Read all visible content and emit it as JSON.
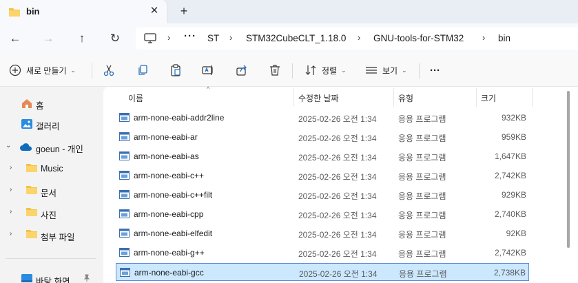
{
  "tab": {
    "title": "bin",
    "close_glyph": "✕",
    "new_glyph": "+"
  },
  "nav": {
    "back": "←",
    "forward": "→",
    "up": "↑",
    "refresh": "↻"
  },
  "breadcrumb": {
    "more": "···",
    "sep": "›",
    "items": [
      "ST",
      "STM32CubeCLT_1.18.0",
      "GNU-tools-for-STM32",
      "bin"
    ]
  },
  "commands": {
    "new_label": "새로 만들기",
    "sort_label": "정렬",
    "view_label": "보기",
    "more": "···",
    "chev": "⌄"
  },
  "sidebar": {
    "home": "홈",
    "gallery": "갤러리",
    "onedrive": "goeun - 개인",
    "folders": [
      "Music",
      "문서",
      "사진",
      "첨부 파일"
    ],
    "desktop": "바탕 화면",
    "expand": "›",
    "expanded": "⌄"
  },
  "columns": {
    "name": "이름",
    "date": "수정한 날짜",
    "type": "유형",
    "size": "크기",
    "sort_glyph": "^"
  },
  "files": [
    {
      "name": "arm-none-eabi-addr2line",
      "date": "2025-02-26 오전 1:34",
      "type": "응용 프로그램",
      "size": "932KB"
    },
    {
      "name": "arm-none-eabi-ar",
      "date": "2025-02-26 오전 1:34",
      "type": "응용 프로그램",
      "size": "959KB"
    },
    {
      "name": "arm-none-eabi-as",
      "date": "2025-02-26 오전 1:34",
      "type": "응용 프로그램",
      "size": "1,647KB"
    },
    {
      "name": "arm-none-eabi-c++",
      "date": "2025-02-26 오전 1:34",
      "type": "응용 프로그램",
      "size": "2,742KB"
    },
    {
      "name": "arm-none-eabi-c++filt",
      "date": "2025-02-26 오전 1:34",
      "type": "응용 프로그램",
      "size": "929KB"
    },
    {
      "name": "arm-none-eabi-cpp",
      "date": "2025-02-26 오전 1:34",
      "type": "응용 프로그램",
      "size": "2,740KB"
    },
    {
      "name": "arm-none-eabi-elfedit",
      "date": "2025-02-26 오전 1:34",
      "type": "응용 프로그램",
      "size": "92KB"
    },
    {
      "name": "arm-none-eabi-g++",
      "date": "2025-02-26 오전 1:34",
      "type": "응용 프로그램",
      "size": "2,742KB"
    },
    {
      "name": "arm-none-eabi-gcc",
      "date": "2025-02-26 오전 1:34",
      "type": "응용 프로그램",
      "size": "2,738KB"
    }
  ],
  "colors": {
    "folder": "#f5c242",
    "selection_bg": "#cce8ff",
    "selection_border": "#5b8ed7",
    "onedrive": "#0f6cbd"
  }
}
